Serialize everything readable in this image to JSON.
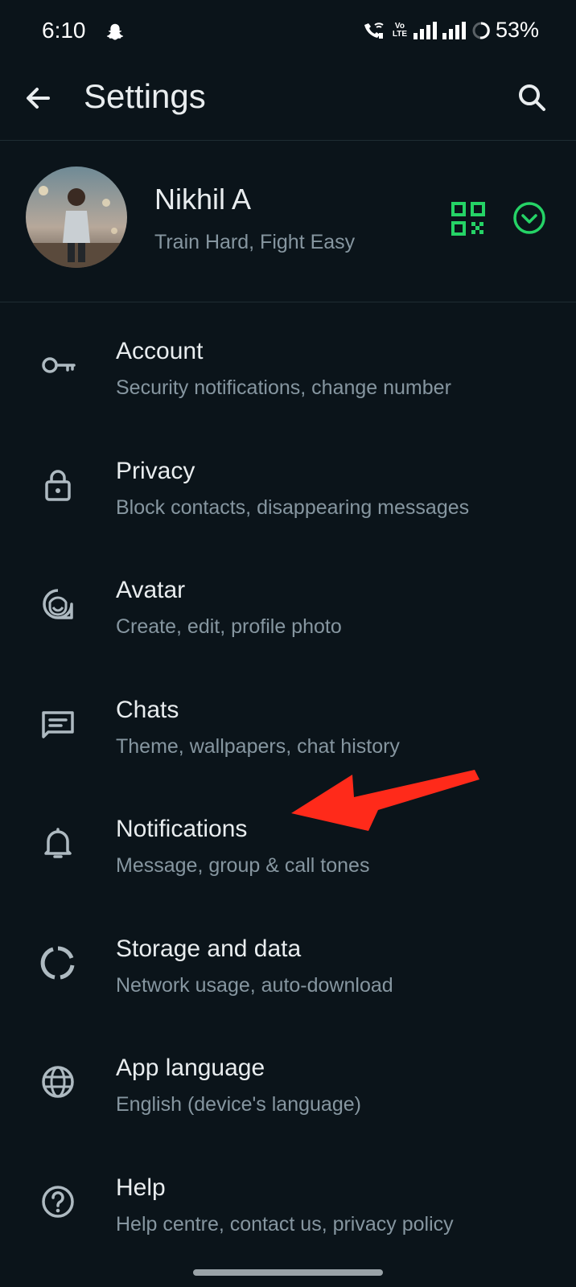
{
  "status_bar": {
    "time": "6:10",
    "volte_top": "Vo",
    "volte_bottom": "LTE",
    "battery_text": "53%"
  },
  "header": {
    "title": "Settings",
    "back_icon": "arrow-left-icon",
    "search_icon": "search-icon"
  },
  "profile": {
    "name": "Nikhil A",
    "about": "Train Hard, Fight Easy",
    "qr_icon": "qr-code-icon",
    "chevron_icon": "chevron-down-circle-icon",
    "accent_color": "#25d366"
  },
  "settings": {
    "items": [
      {
        "icon": "key-icon",
        "title": "Account",
        "subtitle": "Security notifications, change number"
      },
      {
        "icon": "lock-icon",
        "title": "Privacy",
        "subtitle": "Block contacts, disappearing messages"
      },
      {
        "icon": "avatar-face-icon",
        "title": "Avatar",
        "subtitle": "Create, edit, profile photo"
      },
      {
        "icon": "chat-icon",
        "title": "Chats",
        "subtitle": "Theme, wallpapers, chat history"
      },
      {
        "icon": "bell-icon",
        "title": "Notifications",
        "subtitle": "Message, group & call tones"
      },
      {
        "icon": "storage-circle-icon",
        "title": "Storage and data",
        "subtitle": "Network usage, auto-download"
      },
      {
        "icon": "globe-icon",
        "title": "App language",
        "subtitle": "English (device's language)"
      },
      {
        "icon": "help-circle-icon",
        "title": "Help",
        "subtitle": "Help centre, contact us, privacy policy"
      }
    ]
  },
  "colors": {
    "background": "#0b141a",
    "primary_text": "#e9edef",
    "secondary_text": "#8696a0",
    "icon": "#aebac1",
    "annotation_arrow": "#ff2a1a"
  }
}
